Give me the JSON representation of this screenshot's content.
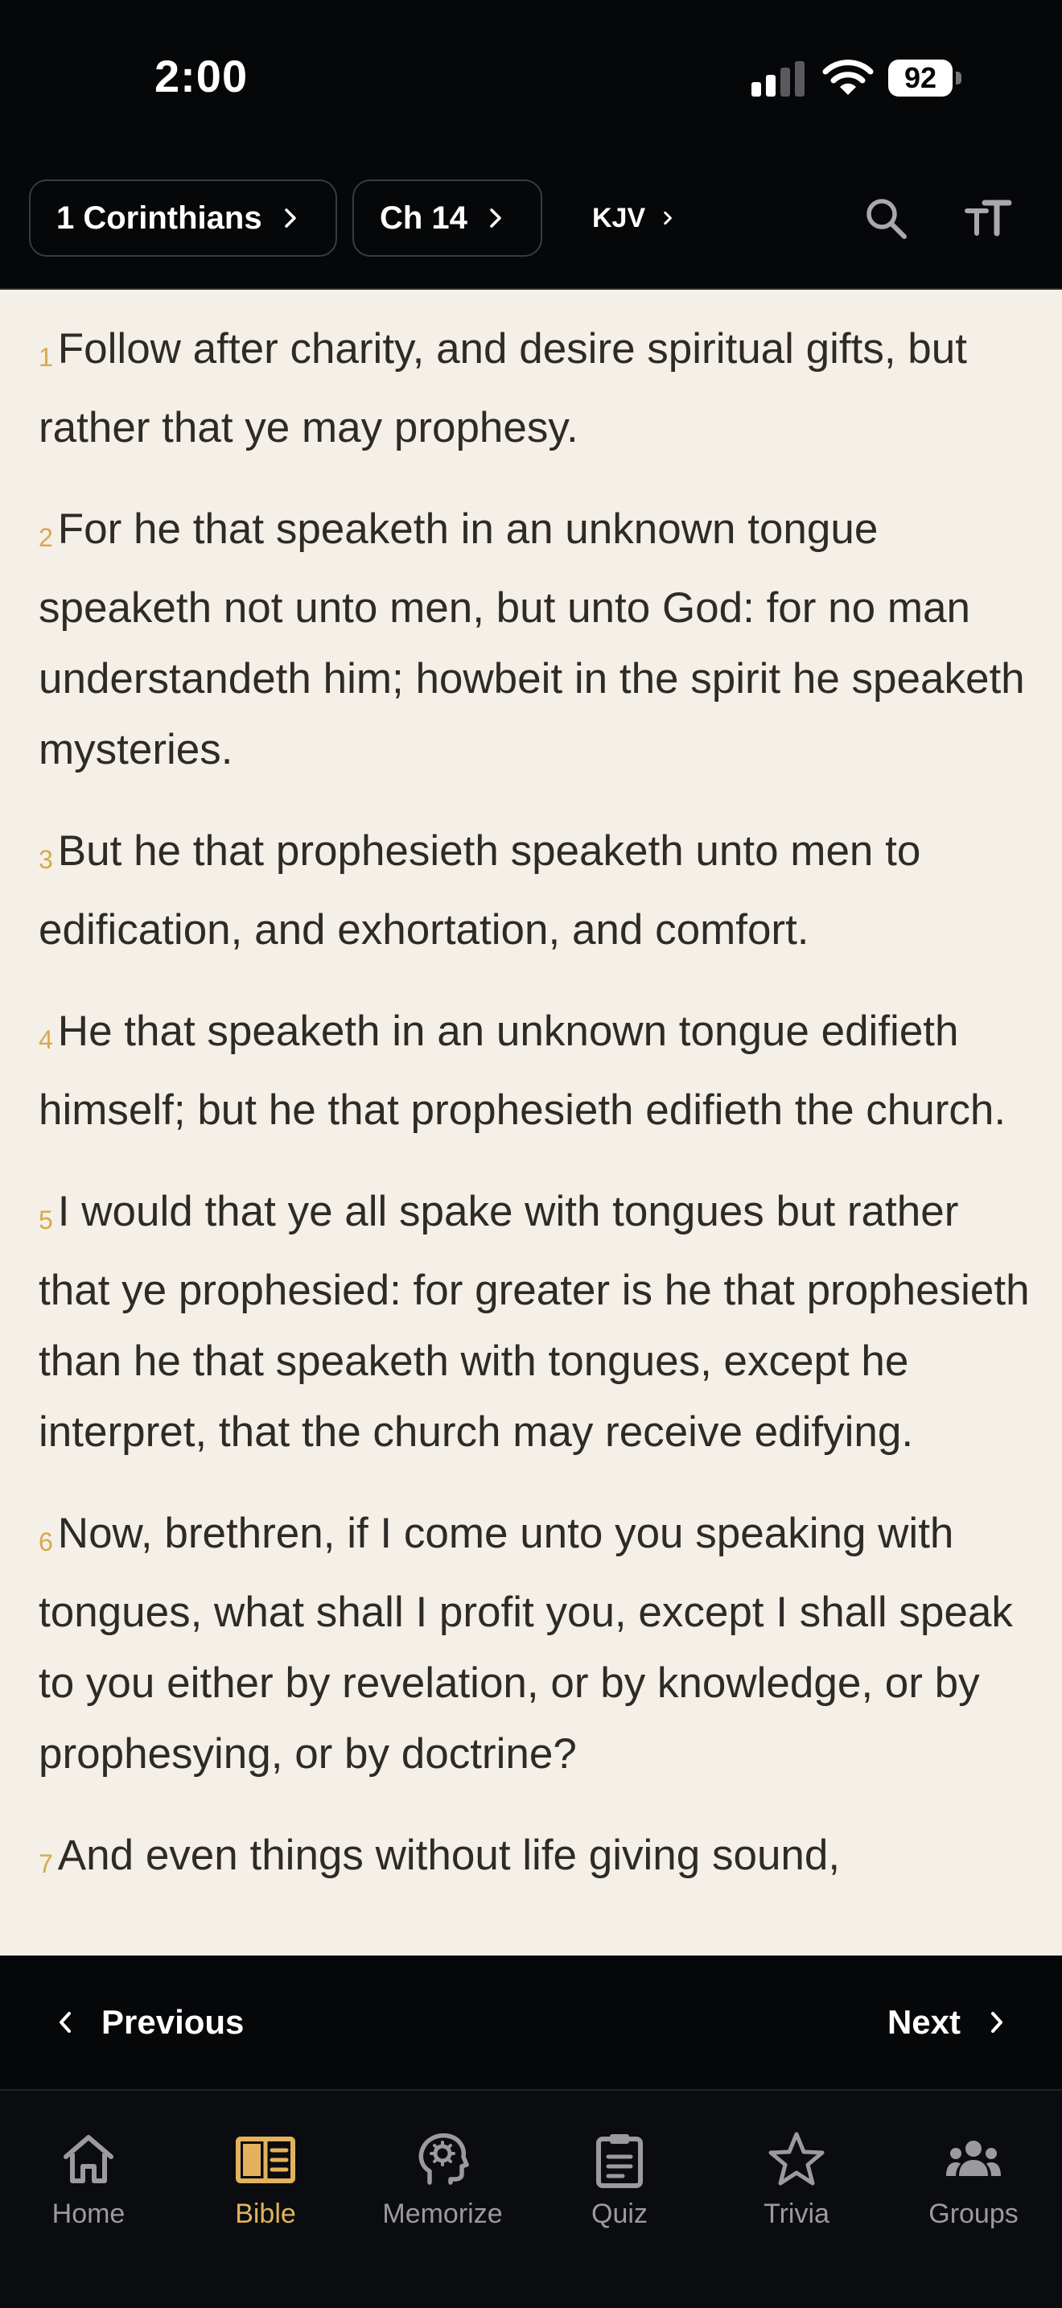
{
  "status_bar": {
    "time": "2:00",
    "battery": "92"
  },
  "toolbar": {
    "book": "1 Corinthians",
    "chapter": "Ch 14",
    "version": "KJV"
  },
  "verses": [
    {
      "num": "1",
      "text": "Follow after charity, and desire spiritual gifts, but rather that ye may prophesy."
    },
    {
      "num": "2",
      "text": "For he that speaketh in an unknown tongue speaketh not unto men, but unto God: for no man understandeth him; howbeit in the spirit he speaketh mysteries."
    },
    {
      "num": "3",
      "text": "But he that prophesieth speaketh unto men to edification, and exhortation, and comfort."
    },
    {
      "num": "4",
      "text": "He that speaketh in an unknown tongue edifieth himself; but he that prophesieth edifieth the church."
    },
    {
      "num": "5",
      "text": "I would that ye all spake with tongues but rather that ye prophesied: for greater is he that prophesieth than he that speaketh with tongues, except he interpret, that the church may receive edifying."
    },
    {
      "num": "6",
      "text": "Now, brethren, if I come unto you speaking with tongues, what shall I profit you, except I shall speak to you either by revelation, or by knowledge, or by prophesying, or by doctrine?"
    },
    {
      "num": "7",
      "text": "And even things without life giving sound,"
    }
  ],
  "pager": {
    "previous": "Previous",
    "next": "Next"
  },
  "tabs": [
    {
      "label": "Home",
      "icon": "home-icon",
      "active": false
    },
    {
      "label": "Bible",
      "icon": "book-icon",
      "active": true
    },
    {
      "label": "Memorize",
      "icon": "brain-head-icon",
      "active": false
    },
    {
      "label": "Quiz",
      "icon": "clipboard-icon",
      "active": false
    },
    {
      "label": "Trivia",
      "icon": "star-icon",
      "active": false
    },
    {
      "label": "Groups",
      "icon": "people-icon",
      "active": false
    }
  ],
  "colors": {
    "accent": "#e2b35c",
    "reading_background": "#f4efe7",
    "verse_number": "#d6a94a",
    "chrome_background": "#060709"
  }
}
